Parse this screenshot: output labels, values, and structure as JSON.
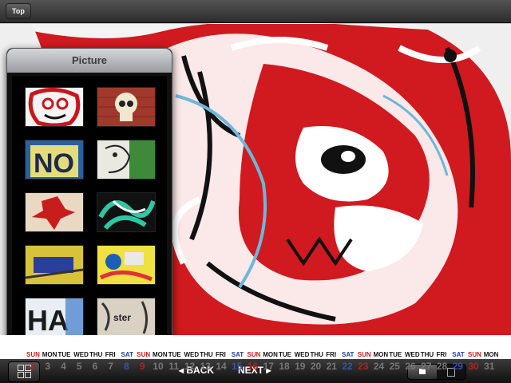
{
  "header": {
    "top_label": "Top"
  },
  "popover": {
    "title": "Picture",
    "thumbnails": [
      {
        "name": "thumb-face-red"
      },
      {
        "name": "thumb-skull"
      },
      {
        "name": "thumb-no"
      },
      {
        "name": "thumb-face-green"
      },
      {
        "name": "thumb-red-blot"
      },
      {
        "name": "thumb-green-swirl"
      },
      {
        "name": "thumb-yellow-blue"
      },
      {
        "name": "thumb-colorful-tags"
      },
      {
        "name": "thumb-ha"
      },
      {
        "name": "thumb-poster-face"
      }
    ]
  },
  "calendar": {
    "days": [
      {
        "name": "SUN",
        "num": "2"
      },
      {
        "name": "MON",
        "num": "3"
      },
      {
        "name": "TUE",
        "num": "4"
      },
      {
        "name": "WED",
        "num": "5"
      },
      {
        "name": "THU",
        "num": "6"
      },
      {
        "name": "FRI",
        "num": "7"
      },
      {
        "name": "SAT",
        "num": "8"
      },
      {
        "name": "SUN",
        "num": "9"
      },
      {
        "name": "MON",
        "num": "10"
      },
      {
        "name": "TUE",
        "num": "11"
      },
      {
        "name": "WED",
        "num": "12"
      },
      {
        "name": "THU",
        "num": "13"
      },
      {
        "name": "FRI",
        "num": "14"
      },
      {
        "name": "SAT",
        "num": "15"
      },
      {
        "name": "SUN",
        "num": "16"
      },
      {
        "name": "MON",
        "num": "17"
      },
      {
        "name": "TUE",
        "num": "18"
      },
      {
        "name": "WED",
        "num": "19"
      },
      {
        "name": "THU",
        "num": "20"
      },
      {
        "name": "FRI",
        "num": "21"
      },
      {
        "name": "SAT",
        "num": "22"
      },
      {
        "name": "SUN",
        "num": "23"
      },
      {
        "name": "MON",
        "num": "24"
      },
      {
        "name": "TUE",
        "num": "25"
      },
      {
        "name": "WED",
        "num": "26"
      },
      {
        "name": "THU",
        "num": "27"
      },
      {
        "name": "FRI",
        "num": "28"
      },
      {
        "name": "SAT",
        "num": "29"
      },
      {
        "name": "SUN",
        "num": "30"
      },
      {
        "name": "MON",
        "num": "31"
      }
    ],
    "back_label": "◂ BACK",
    "next_label": "NEXT ▸"
  },
  "colors": {
    "sunday": "#cc1b1b",
    "saturday": "#1c3fa6",
    "graffiti_red": "#d3141b"
  }
}
